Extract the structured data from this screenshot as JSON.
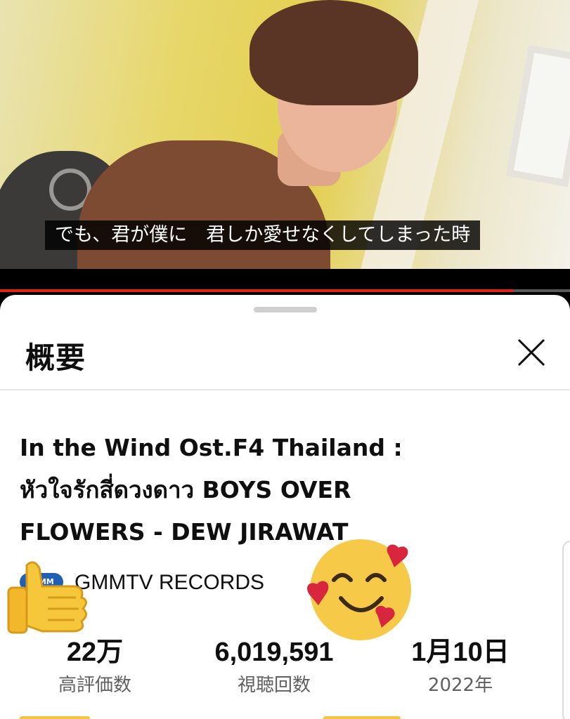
{
  "video": {
    "subtitle": "でも、君が僕に　君しか愛せなくしてしまった時",
    "progress_fraction": 0.9,
    "colors": {
      "progress": "#e62117",
      "track": "#5a5a5a"
    }
  },
  "description_sheet": {
    "heading": "概要",
    "close_icon": "close-icon",
    "title_lines": [
      "In the Wind Ost.F4 Thailand :",
      "หัวใจรักสี่ดวงดาว BOYS OVER",
      "FLOWERS - DEW JIRAWAT"
    ],
    "channel": {
      "logo_text": "G-MM",
      "name": "GMMTV RECORDS"
    },
    "stats": [
      {
        "value": "22万",
        "label": "高評価数"
      },
      {
        "value": "6,019,591",
        "label": "視聴回数"
      },
      {
        "value": "1月10日",
        "label": "2022年"
      }
    ]
  },
  "stickers": {
    "thumb": "thumbs-up-icon",
    "face": "smiling-face-with-hearts-icon"
  }
}
